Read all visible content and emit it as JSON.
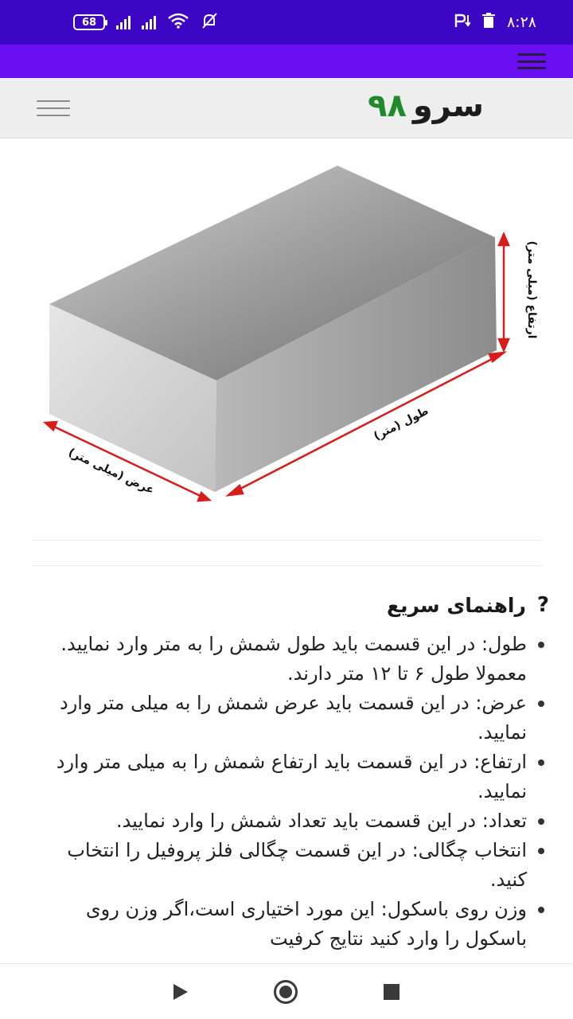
{
  "status_bar": {
    "battery": "68",
    "time": "۸:۲۸",
    "glyphs": [
      "signal-icon",
      "signal-icon",
      "wifi-icon",
      "bell-off-icon",
      "p-notification-icon",
      "download-icon",
      "trash-icon"
    ]
  },
  "header": {
    "logo_word": "سرو",
    "logo_number": "۹۸"
  },
  "diagram": {
    "height_label": "ارتفاع (میلی متر)",
    "length_label": "طول (متر)",
    "width_label": "عرض (میلی متر)",
    "arrow_color": "#d81c1c"
  },
  "guide": {
    "title": "راهنمای سریع",
    "icon": "question-icon",
    "items": [
      "طول: در این قسمت باید طول شمش را به متر وارد نمایید. معمولا طول ۶ تا ۱۲ متر دارند.",
      "عرض: در این قسمت باید عرض شمش را به میلی متر وارد نمایید.",
      "ارتفاع: در این قسمت باید ارتفاع شمش را به میلی متر وارد نمایید.",
      "تعداد: در این قسمت باید تعداد شمش را وارد نمایید.",
      "انتخاب چگالی: در این قسمت چگالی فلز پروفیل را انتخاب کنید.",
      "وزن روی باسکول: این مورد اختیاری است،اگر وزن روی باسکول را وارد کنید نتایج کرفیت"
    ]
  },
  "colors": {
    "status_bar": "#3d06c4",
    "app_bar": "#6a0ff2",
    "logo_number": "#1e8a2a"
  }
}
